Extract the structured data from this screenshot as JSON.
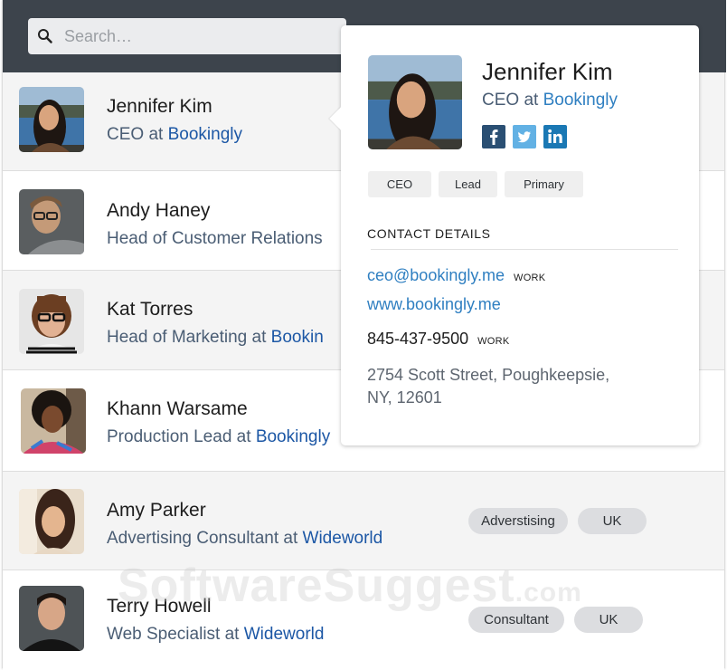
{
  "search": {
    "icon": "search-icon",
    "placeholder": "Search…",
    "value": ""
  },
  "contacts": [
    {
      "name": "Jennifer Kim",
      "role": "CEO",
      "company": "Bookingly",
      "avatar": "avatar-jennifer-kim",
      "tags": []
    },
    {
      "name": "Andy Haney",
      "role": "Head of Customer Relations",
      "company": "",
      "avatar": "avatar-andy-haney",
      "tags": []
    },
    {
      "name": "Kat Torres",
      "role": "Head of Marketing",
      "company": "Bookin",
      "avatar": "avatar-kat-torres",
      "tags": []
    },
    {
      "name": "Khann Warsame",
      "role": "Production Lead",
      "company": "Bookingly",
      "avatar": "avatar-khann-warsame",
      "tags": []
    },
    {
      "name": "Amy Parker",
      "role": "Advertising Consultant",
      "company": "Wideworld",
      "avatar": "avatar-amy-parker",
      "tags": [
        "Adverstising",
        "UK"
      ]
    },
    {
      "name": "Terry Howell",
      "role": "Web Specialist",
      "company": "Wideworld",
      "avatar": "avatar-terry-howell",
      "tags": [
        "Consultant",
        "UK"
      ]
    }
  ],
  "at_word": "at",
  "popover": {
    "name": "Jennifer Kim",
    "role": "CEO",
    "company": "Bookingly",
    "social": [
      {
        "icon": "facebook-icon",
        "glyph": "f"
      },
      {
        "icon": "twitter-icon",
        "glyph": "t"
      },
      {
        "icon": "linkedin-icon",
        "glyph": "in"
      }
    ],
    "tags": [
      "CEO",
      "Lead",
      "Primary"
    ],
    "section_title": "CONTACT DETAILS",
    "email": {
      "value": "ceo@bookingly.me",
      "label": "WORK"
    },
    "website": "www.bookingly.me",
    "phone": {
      "value": "845-437-9500",
      "label": "WORK"
    },
    "address_line1": "2754 Scott Street, Poughkeepsie,",
    "address_line2": "NY, 12601"
  },
  "colors": {
    "header_bg": "#3d444c",
    "link": "#2f7fc1",
    "company_link": "#1c57a5",
    "facebook": "#2a4f73",
    "twitter": "#62b1e4",
    "linkedin": "#1a78b4"
  },
  "watermark": {
    "main": "SoftwareSuggest",
    "suffix": ".com"
  }
}
